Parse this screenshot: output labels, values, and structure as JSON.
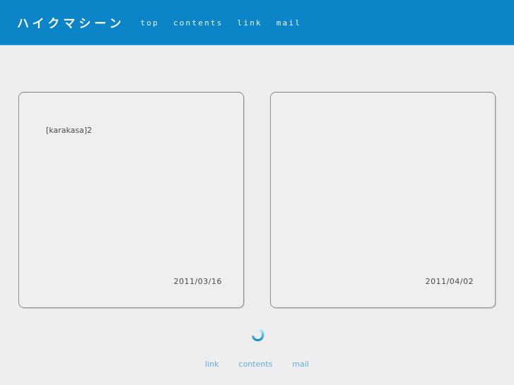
{
  "header": {
    "title": "ハイクマシーン",
    "background_color": "#0b85c8",
    "title_color": "#ffffff",
    "nav": [
      {
        "label": "top"
      },
      {
        "label": "contents"
      },
      {
        "label": "link"
      },
      {
        "label": "mail"
      }
    ]
  },
  "main": {
    "background_color": "#eeeeee",
    "cards": [
      {
        "title": "[karakasa]2",
        "date": "2011/03/16"
      },
      {
        "title": "",
        "date": "2011/04/02"
      }
    ]
  },
  "footer": {
    "back_to_top_icon": "curved-return-arrow-icon",
    "icon_color": "#2f9fd6",
    "link_color": "#5aaee2",
    "nav": [
      {
        "label": "link"
      },
      {
        "label": "contents"
      },
      {
        "label": "mail"
      }
    ]
  }
}
